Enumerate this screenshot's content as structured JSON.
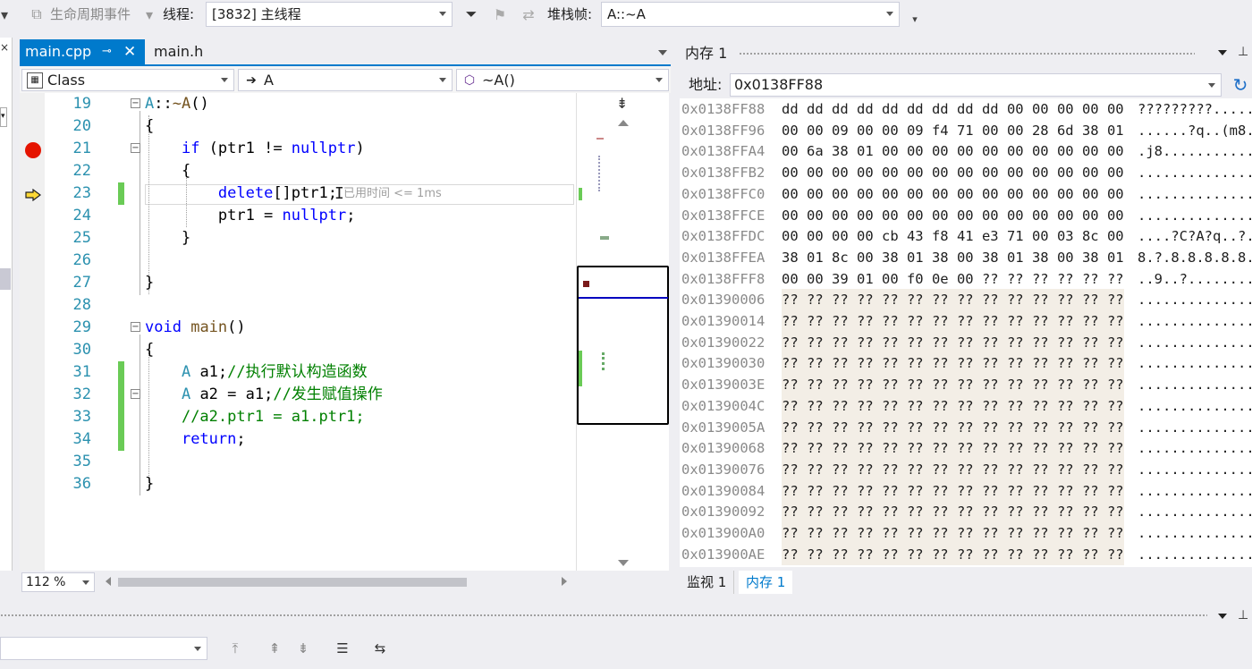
{
  "toolbar": {
    "lifecycle_label": "生命周期事件",
    "thread_label": "线程:",
    "thread_value": "[3832] 主线程",
    "stackframe_label": "堆栈帧:",
    "stackframe_value": "A::~A"
  },
  "editor": {
    "tabs": [
      {
        "label": "main.cpp",
        "active": true
      },
      {
        "label": "main.h",
        "active": false
      }
    ],
    "nav": {
      "scope": "Class",
      "type": "A",
      "member": "~A()"
    },
    "lines": [
      {
        "num": "19",
        "html_tokens": [
          {
            "t": "A::~A()",
            "c": "plain"
          }
        ]
      },
      {
        "num": "20",
        "text": "{"
      },
      {
        "num": "21",
        "text": "    if (ptr1 != nullptr)"
      },
      {
        "num": "22",
        "text": "    {"
      },
      {
        "num": "23",
        "text": "        delete[]ptr1;"
      },
      {
        "num": "24",
        "text": "        ptr1 = nullptr;"
      },
      {
        "num": "25",
        "text": "    }"
      },
      {
        "num": "26",
        "text": ""
      },
      {
        "num": "27",
        "text": "}"
      },
      {
        "num": "28",
        "text": ""
      },
      {
        "num": "29",
        "text": "void main()"
      },
      {
        "num": "30",
        "text": "{"
      },
      {
        "num": "31",
        "text": "    A a1;//执行默认构造函数"
      },
      {
        "num": "32",
        "text": "    A a2 = a1;//发生赋值操作"
      },
      {
        "num": "33",
        "text": "    //a2.ptr1 = a1.ptr1;"
      },
      {
        "num": "34",
        "text": "    return;"
      },
      {
        "num": "35",
        "text": ""
      },
      {
        "num": "36",
        "text": "}"
      }
    ],
    "perf_hint": "已用时间 <= 1ms",
    "zoom": "112 %"
  },
  "memory": {
    "title": "内存 1",
    "address_label": "地址:",
    "address_value": "0x0138FF88",
    "rows": [
      {
        "addr": "0x0138FF88",
        "bytes": "dd dd dd dd dd dd dd dd dd 00 00 00 00 00",
        "ascii": "?????????.....",
        "unknown": false
      },
      {
        "addr": "0x0138FF96",
        "bytes": "00 00 09 00 00 09 f4 71 00 00 28 6d 38 01",
        "ascii": "......?q..(m8.",
        "unknown": false
      },
      {
        "addr": "0x0138FFA4",
        "bytes": "00 6a 38 01 00 00 00 00 00 00 00 00 00 00",
        "ascii": ".j8...........",
        "unknown": false
      },
      {
        "addr": "0x0138FFB2",
        "bytes": "00 00 00 00 00 00 00 00 00 00 00 00 00 00",
        "ascii": "..............",
        "unknown": false
      },
      {
        "addr": "0x0138FFC0",
        "bytes": "00 00 00 00 00 00 00 00 00 00 00 00 00 00",
        "ascii": "..............",
        "unknown": false
      },
      {
        "addr": "0x0138FFCE",
        "bytes": "00 00 00 00 00 00 00 00 00 00 00 00 00 00",
        "ascii": "..............",
        "unknown": false
      },
      {
        "addr": "0x0138FFDC",
        "bytes": "00 00 00 00 cb 43 f8 41 e3 71 00 03 8c 00",
        "ascii": "....?C?A?q..?.",
        "unknown": false
      },
      {
        "addr": "0x0138FFEA",
        "bytes": "38 01 8c 00 38 01 38 00 38 01 38 00 38 01",
        "ascii": "8.?.8.8.8.8.8.",
        "unknown": false
      },
      {
        "addr": "0x0138FFF8",
        "bytes": "00 00 39 01 00 f0 0e 00 ?? ?? ?? ?? ?? ??",
        "ascii": "..9..?........",
        "unknown": false
      },
      {
        "addr": "0x01390006",
        "bytes": "?? ?? ?? ?? ?? ?? ?? ?? ?? ?? ?? ?? ?? ??",
        "ascii": "..............",
        "unknown": true
      },
      {
        "addr": "0x01390014",
        "bytes": "?? ?? ?? ?? ?? ?? ?? ?? ?? ?? ?? ?? ?? ??",
        "ascii": "..............",
        "unknown": true
      },
      {
        "addr": "0x01390022",
        "bytes": "?? ?? ?? ?? ?? ?? ?? ?? ?? ?? ?? ?? ?? ??",
        "ascii": "..............",
        "unknown": true
      },
      {
        "addr": "0x01390030",
        "bytes": "?? ?? ?? ?? ?? ?? ?? ?? ?? ?? ?? ?? ?? ??",
        "ascii": "..............",
        "unknown": true
      },
      {
        "addr": "0x0139003E",
        "bytes": "?? ?? ?? ?? ?? ?? ?? ?? ?? ?? ?? ?? ?? ??",
        "ascii": "..............",
        "unknown": true
      },
      {
        "addr": "0x0139004C",
        "bytes": "?? ?? ?? ?? ?? ?? ?? ?? ?? ?? ?? ?? ?? ??",
        "ascii": "..............",
        "unknown": true
      },
      {
        "addr": "0x0139005A",
        "bytes": "?? ?? ?? ?? ?? ?? ?? ?? ?? ?? ?? ?? ?? ??",
        "ascii": "..............",
        "unknown": true
      },
      {
        "addr": "0x01390068",
        "bytes": "?? ?? ?? ?? ?? ?? ?? ?? ?? ?? ?? ?? ?? ??",
        "ascii": "..............",
        "unknown": true
      },
      {
        "addr": "0x01390076",
        "bytes": "?? ?? ?? ?? ?? ?? ?? ?? ?? ?? ?? ?? ?? ??",
        "ascii": "..............",
        "unknown": true
      },
      {
        "addr": "0x01390084",
        "bytes": "?? ?? ?? ?? ?? ?? ?? ?? ?? ?? ?? ?? ?? ??",
        "ascii": "..............",
        "unknown": true
      },
      {
        "addr": "0x01390092",
        "bytes": "?? ?? ?? ?? ?? ?? ?? ?? ?? ?? ?? ?? ?? ??",
        "ascii": "..............",
        "unknown": true
      },
      {
        "addr": "0x013900A0",
        "bytes": "?? ?? ?? ?? ?? ?? ?? ?? ?? ?? ?? ?? ?? ??",
        "ascii": "..............",
        "unknown": true
      },
      {
        "addr": "0x013900AE",
        "bytes": "?? ?? ?? ?? ?? ?? ?? ?? ?? ?? ?? ?? ?? ??",
        "ascii": "..............",
        "unknown": true
      }
    ],
    "tabs": [
      {
        "label": "监视 1"
      },
      {
        "label": "内存 1"
      }
    ]
  },
  "colors": {
    "accent": "#007acc",
    "breakpoint": "#e51400",
    "keyword": "#0000ff",
    "comment": "#008000",
    "change_margin": "#6acb56"
  }
}
